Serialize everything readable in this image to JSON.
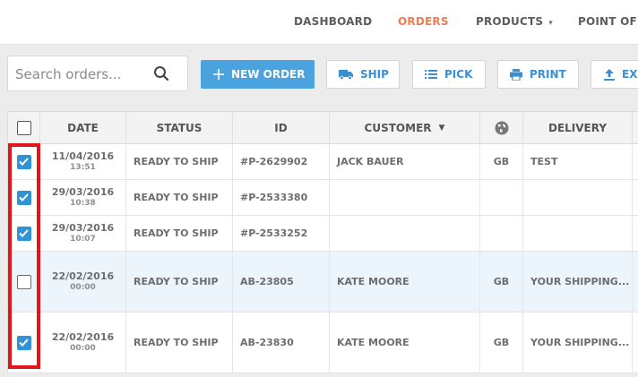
{
  "nav": {
    "items": [
      {
        "label": "DASHBOARD",
        "active": false
      },
      {
        "label": "ORDERS",
        "active": true
      },
      {
        "label": "PRODUCTS",
        "active": false,
        "has_caret": true
      },
      {
        "label": "POINT OF SA",
        "active": false
      }
    ]
  },
  "search": {
    "placeholder": "Search orders..."
  },
  "toolbar": {
    "new_order": "NEW ORDER",
    "ship": "SHIP",
    "pick": "PICK",
    "print": "PRINT",
    "export": "EX"
  },
  "table": {
    "headers": {
      "date": "DATE",
      "status": "STATUS",
      "id": "ID",
      "customer": "CUSTOMER",
      "delivery": "DELIVERY"
    },
    "rows": [
      {
        "checked": true,
        "date": "11/04/2016",
        "time": "13:51",
        "status": "READY TO SHIP",
        "id": "#P-2629902",
        "customer": "JACK BAUER",
        "country": "GB",
        "delivery": "TEST"
      },
      {
        "checked": true,
        "date": "29/03/2016",
        "time": "10:38",
        "status": "READY TO SHIP",
        "id": "#P-2533380",
        "customer": "",
        "country": "",
        "delivery": ""
      },
      {
        "checked": true,
        "date": "29/03/2016",
        "time": "10:07",
        "status": "READY TO SHIP",
        "id": "#P-2533252",
        "customer": "",
        "country": "",
        "delivery": ""
      },
      {
        "checked": false,
        "date": "22/02/2016",
        "time": "00:00",
        "status": "READY TO SHIP",
        "id": "AB-23805",
        "customer": "KATE MOORE",
        "country": "GB",
        "delivery": "YOUR SHIPPING..."
      },
      {
        "checked": true,
        "date": "22/02/2016",
        "time": "00:00",
        "status": "READY TO SHIP",
        "id": "AB-23830",
        "customer": "KATE MOORE",
        "country": "GB",
        "delivery": "YOUR SHIPPING..."
      }
    ]
  },
  "colors": {
    "accent": "#f07c50",
    "primary_button": "#4aa2de",
    "link_blue": "#3a8fd3",
    "checkbox": "#2f93d6",
    "highlight": "#e0161c"
  }
}
